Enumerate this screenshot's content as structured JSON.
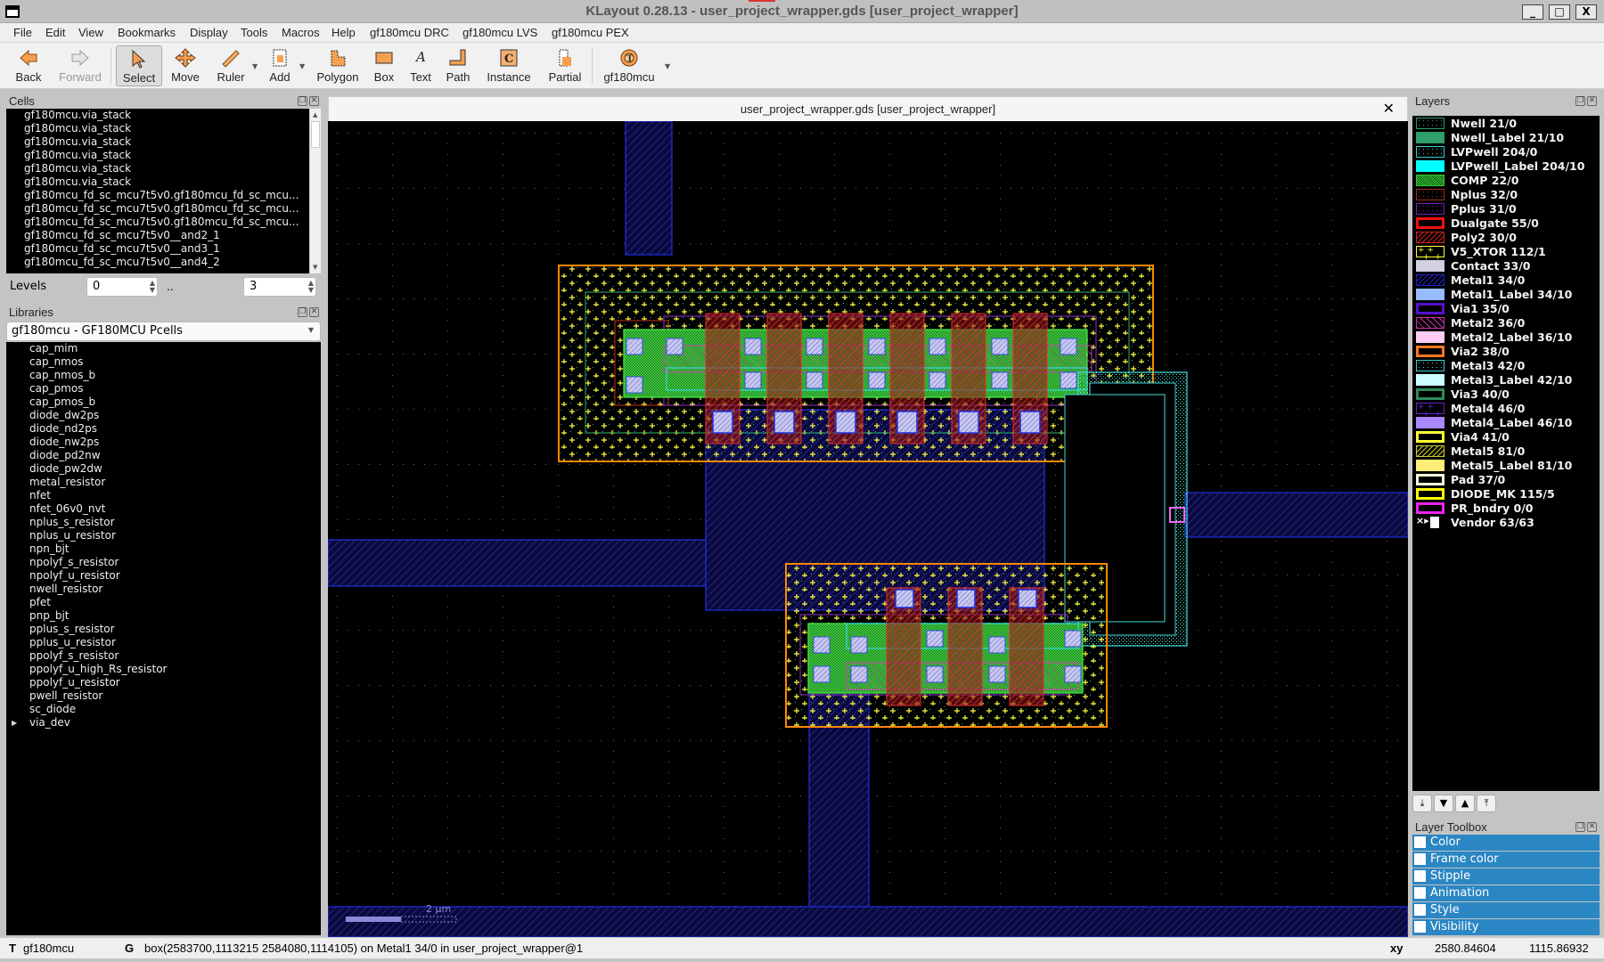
{
  "window": {
    "title": "KLayout 0.28.13 - user_project_wrapper.gds [user_project_wrapper]",
    "buttons": {
      "minimize": "_",
      "maximize": "□",
      "close": "X"
    }
  },
  "menu": [
    "File",
    "Edit",
    "View",
    "Bookmarks",
    "Display",
    "Tools",
    "Macros",
    "Help",
    "gf180mcu DRC",
    "gf180mcu LVS",
    "gf180mcu PEX"
  ],
  "toolbar": [
    {
      "label": "Back",
      "icon": "arrow-left-icon"
    },
    {
      "label": "Forward",
      "icon": "arrow-right-icon",
      "disabled": true
    },
    {
      "label": "Select",
      "icon": "select-arrow-icon",
      "active": true
    },
    {
      "label": "Move",
      "icon": "move-icon"
    },
    {
      "label": "Ruler",
      "icon": "ruler-icon",
      "dropdown": true
    },
    {
      "label": "Add",
      "icon": "add-icon",
      "dropdown": true
    },
    {
      "label": "Polygon",
      "icon": "polygon-icon"
    },
    {
      "label": "Box",
      "icon": "box-icon"
    },
    {
      "label": "Text",
      "icon": "text-icon"
    },
    {
      "label": "Path",
      "icon": "path-icon"
    },
    {
      "label": "Instance",
      "icon": "instance-icon"
    },
    {
      "label": "Partial",
      "icon": "partial-icon"
    },
    {
      "label": "gf180mcu",
      "icon": "tech-gear-icon",
      "dropdown": true
    }
  ],
  "cells": {
    "title": "Cells",
    "items": [
      "gf180mcu.via_stack",
      "gf180mcu.via_stack",
      "gf180mcu.via_stack",
      "gf180mcu.via_stack",
      "gf180mcu.via_stack",
      "gf180mcu.via_stack",
      "gf180mcu_fd_sc_mcu7t5v0.gf180mcu_fd_sc_mcu...",
      "gf180mcu_fd_sc_mcu7t5v0.gf180mcu_fd_sc_mcu...",
      "gf180mcu_fd_sc_mcu7t5v0.gf180mcu_fd_sc_mcu...",
      "gf180mcu_fd_sc_mcu7t5v0__and2_1",
      "gf180mcu_fd_sc_mcu7t5v0__and3_1",
      "gf180mcu_fd_sc_mcu7t5v0__and4_2"
    ],
    "levels_label": "Levels",
    "level_from": "0",
    "level_sep": "..",
    "level_to": "3"
  },
  "libraries": {
    "title": "Libraries",
    "selected": "gf180mcu - GF180MCU Pcells",
    "items": [
      "cap_mim",
      "cap_nmos",
      "cap_nmos_b",
      "cap_pmos",
      "cap_pmos_b",
      "diode_dw2ps",
      "diode_nd2ps",
      "diode_nw2ps",
      "diode_pd2nw",
      "diode_pw2dw",
      "metal_resistor",
      "nfet",
      "nfet_06v0_nvt",
      "nplus_s_resistor",
      "nplus_u_resistor",
      "npn_bjt",
      "npolyf_s_resistor",
      "npolyf_u_resistor",
      "nwell_resistor",
      "pfet",
      "pnp_bjt",
      "pplus_s_resistor",
      "pplus_u_resistor",
      "ppolyf_s_resistor",
      "ppolyf_u_high_Rs_resistor",
      "ppolyf_u_resistor",
      "pwell_resistor",
      "sc_diode",
      "via_dev"
    ],
    "expandable": "via_dev"
  },
  "view": {
    "tab_title": "user_project_wrapper.gds [user_project_wrapper]",
    "scale_label": "2 µm"
  },
  "layers": {
    "title": "Layers",
    "items": [
      {
        "name": "Nwell 21/0",
        "color": "#2e9e6a",
        "fill": "dots"
      },
      {
        "name": "Nwell_Label 21/10",
        "color": "#2e9e6a",
        "fill": "solid"
      },
      {
        "name": "LVPwell 204/0",
        "color": "#33cccc",
        "fill": "dots"
      },
      {
        "name": "LVPwell_Label 204/10",
        "color": "#00ffff",
        "fill": "solid"
      },
      {
        "name": "COMP 22/0",
        "color": "#33cc33",
        "fill": "dense"
      },
      {
        "name": "Nplus 32/0",
        "color": "#a03020",
        "fill": "dots"
      },
      {
        "name": "Pplus 31/0",
        "color": "#7a20b0",
        "fill": "dots"
      },
      {
        "name": "Dualgate 55/0",
        "color": "#ee1111",
        "fill": "frame"
      },
      {
        "name": "Poly2 30/0",
        "color": "#cc2020",
        "fill": "hatch"
      },
      {
        "name": "V5_XTOR 112/1",
        "color": "#ffff33",
        "fill": "cross"
      },
      {
        "name": "Contact 33/0",
        "color": "#d0d0e0",
        "fill": "solid"
      },
      {
        "name": "Metal1 34/0",
        "color": "#2020c0",
        "fill": "hatch"
      },
      {
        "name": "Metal1_Label 34/10",
        "color": "#99bbff",
        "fill": "solid"
      },
      {
        "name": "Via1 35/0",
        "color": "#5511cc",
        "fill": "frame"
      },
      {
        "name": "Metal2 36/0",
        "color": "#cc33aa",
        "fill": "backhatch"
      },
      {
        "name": "Metal2_Label 36/10",
        "color": "#ffccf4",
        "fill": "solid"
      },
      {
        "name": "Via2 38/0",
        "color": "#ff7722",
        "fill": "frame"
      },
      {
        "name": "Metal3 42/0",
        "color": "#44cccc",
        "fill": "dots"
      },
      {
        "name": "Metal3_Label 42/10",
        "color": "#ccffff",
        "fill": "solid"
      },
      {
        "name": "Via3 40/0",
        "color": "#2e8a5a",
        "fill": "frame"
      },
      {
        "name": "Metal4 46/0",
        "color": "#6622cc",
        "fill": "cross"
      },
      {
        "name": "Metal4_Label 46/10",
        "color": "#aa88ff",
        "fill": "solid"
      },
      {
        "name": "Via4 41/0",
        "color": "#ffff33",
        "fill": "frame"
      },
      {
        "name": "Metal5 81/0",
        "color": "#cccc33",
        "fill": "hatch"
      },
      {
        "name": "Metal5_Label 81/10",
        "color": "#ffee77",
        "fill": "solid"
      },
      {
        "name": "Pad 37/0",
        "color": "#fff8d8",
        "fill": "frame"
      },
      {
        "name": "DIODE_MK 115/5",
        "color": "#ffff00",
        "fill": "frame"
      },
      {
        "name": "PR_bndry 0/0",
        "color": "#ee22ee",
        "fill": "frame"
      },
      {
        "name": "Vendor 63/63",
        "color": "#ffffff",
        "fill": "vendor"
      }
    ]
  },
  "layer_toolbox": {
    "title": "Layer Toolbox",
    "items": [
      "Color",
      "Frame color",
      "Stipple",
      "Animation",
      "Style",
      "Visibility"
    ]
  },
  "status": {
    "tech_prefix": "T",
    "tech": "gf180mcu",
    "geom_prefix": "G",
    "selection": "box(2583700,1113215 2584080,1114105) on Metal1 34/0 in user_project_wrapper@1",
    "coord_mode": "xy",
    "x": "2580.84604",
    "y": "1115.86932"
  }
}
